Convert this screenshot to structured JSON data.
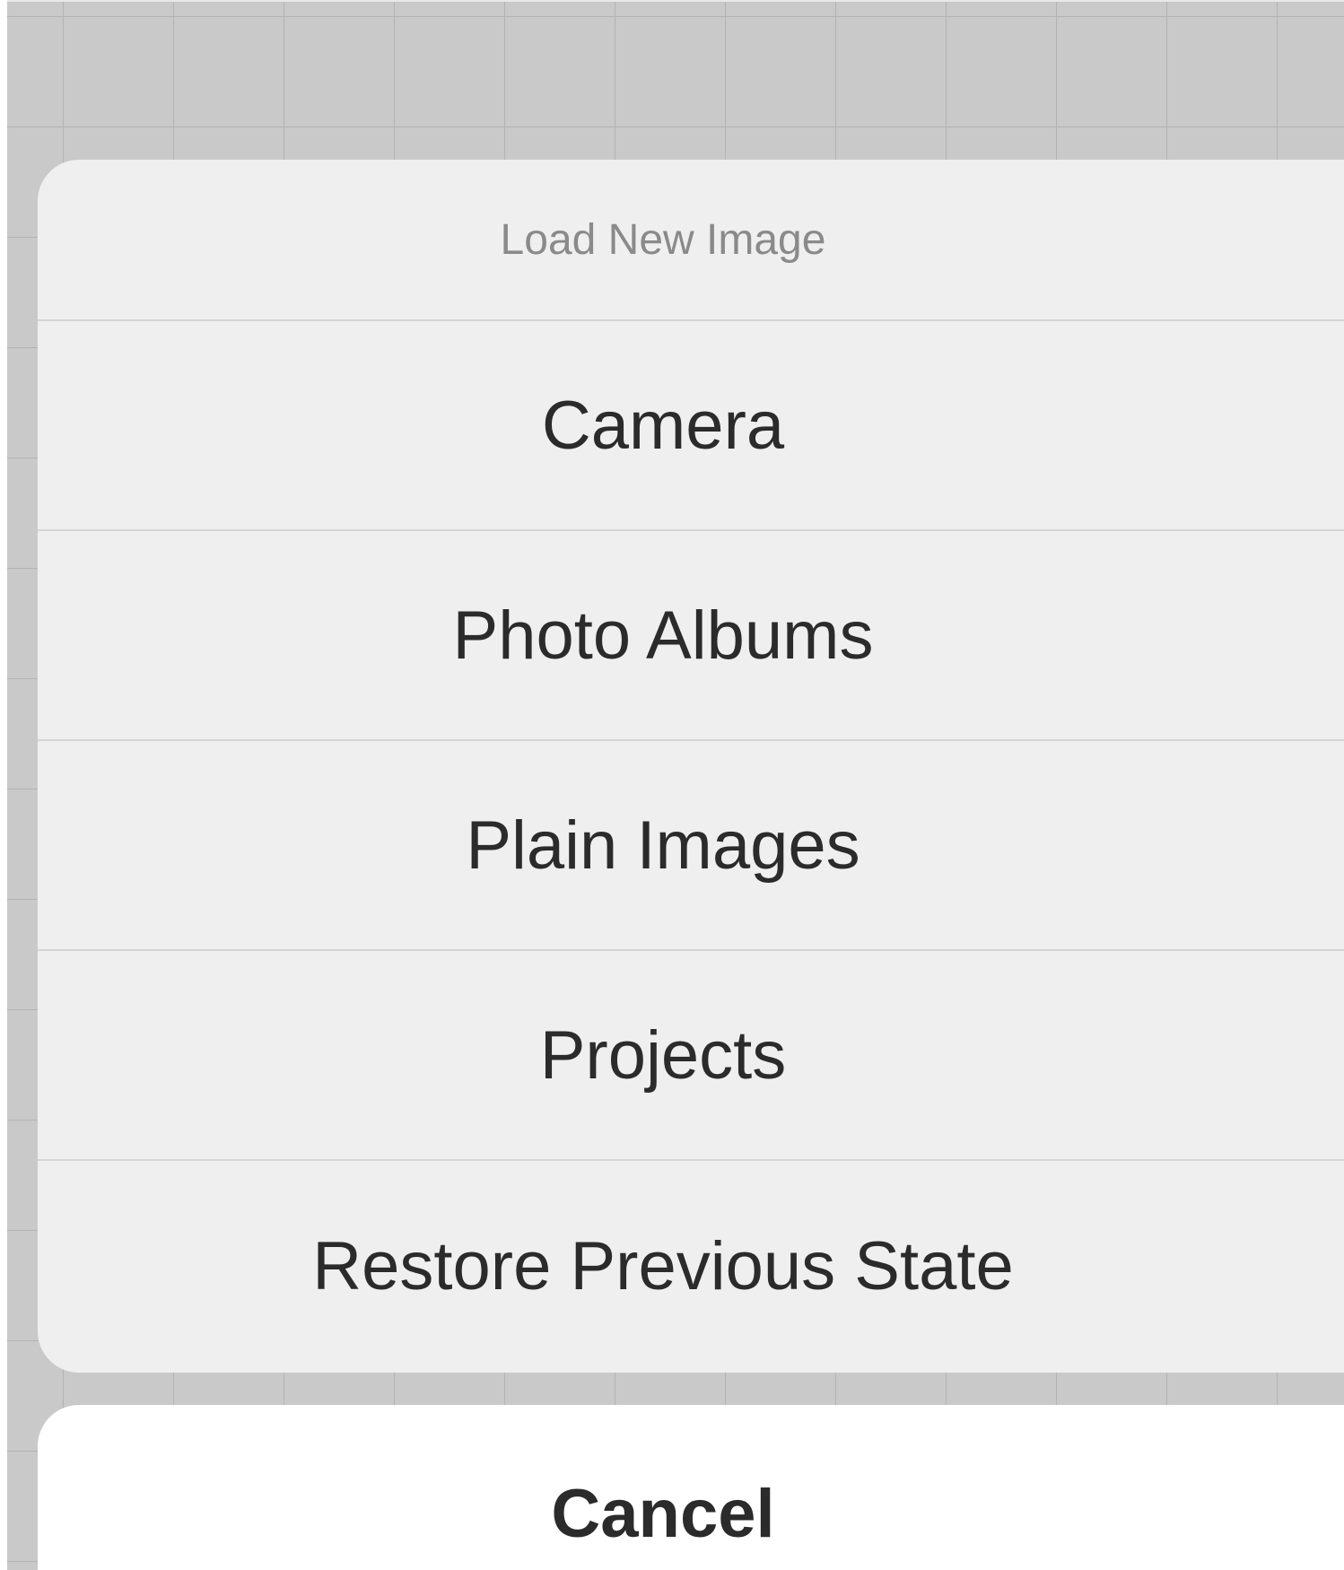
{
  "action_sheet": {
    "title": "Load New Image",
    "actions": [
      {
        "label": "Camera"
      },
      {
        "label": "Photo Albums"
      },
      {
        "label": "Plain Images"
      },
      {
        "label": "Projects"
      },
      {
        "label": "Restore Previous State"
      }
    ],
    "cancel_label": "Cancel"
  },
  "colors": {
    "backdrop": "#c9c9c9",
    "grid_line": "#b3b3b3",
    "sheet_background": "#efefef",
    "cancel_background": "#ffffff",
    "title_text": "#8a8a8a",
    "action_text": "#2b2b2b"
  }
}
